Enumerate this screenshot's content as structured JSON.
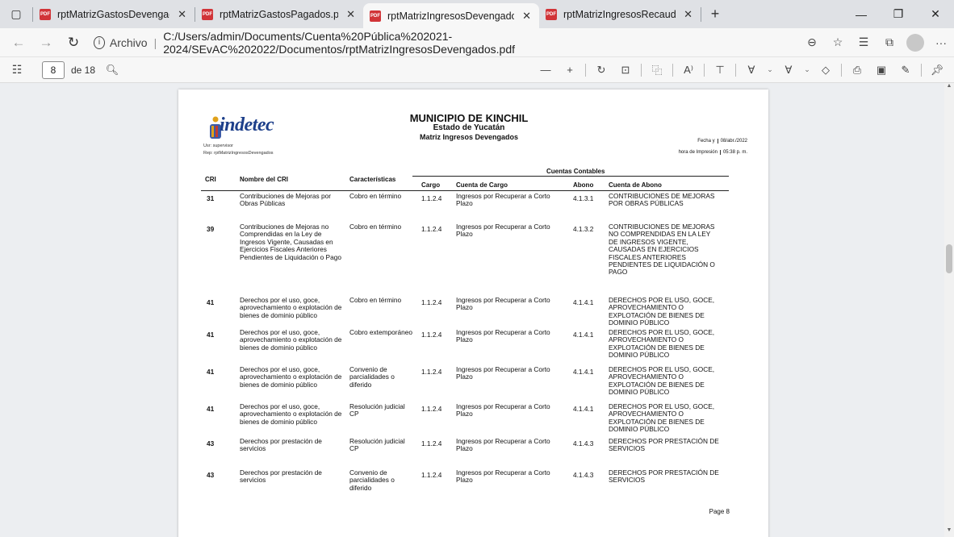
{
  "tabs": [
    {
      "title": "rptMatrizGastosDevengados.pdf",
      "active": false
    },
    {
      "title": "rptMatrizGastosPagados.pdf",
      "active": false
    },
    {
      "title": "rptMatrizIngresosDevengados.pc",
      "active": true
    },
    {
      "title": "rptMatrizIngresosRecaudados.pc",
      "active": false
    }
  ],
  "address": {
    "prefix": "Archivo",
    "url": "C:/Users/admin/Documents/Cuenta%20Pública%202021-2024/SEvAC%202022/Documentos/rptMatrizIngresosDevengados.pdf"
  },
  "pdf_toolbar": {
    "page_current": "8",
    "page_total": "de 18"
  },
  "report": {
    "logo_text": "indetec",
    "usr": "Usr: supervisor",
    "rep": "Rep: rptMatrizIngresosDevengados",
    "title": "MUNICIPIO DE KINCHIL",
    "state": "Estado de Yucatán",
    "subtitle": "Matriz Ingresos Devengados",
    "fecha_label": "Fecha y",
    "fecha_value": "08/abr./2022",
    "hora_label": "hora de Impresión",
    "hora_value": "05:38 p. m.",
    "headers": {
      "cri": "CRI",
      "nombre": "Nombre del CRI",
      "caracteristicas": "Características",
      "cuentas": "Cuentas Contables",
      "cargo": "Cargo",
      "cuenta_cargo": "Cuenta de Cargo",
      "abono": "Abono",
      "cuenta_abono": "Cuenta de Abono"
    },
    "rows": [
      {
        "cri": "31",
        "nombre": "Contribuciones de Mejoras por Obras Públicas",
        "car": "Cobro en término",
        "cargo": "1.1.2.4",
        "ccargo": "Ingresos por Recuperar a Corto Plazo",
        "abono": "4.1.3.1",
        "cabono": "CONTRIBUCIONES DE MEJORAS POR OBRAS PÚBLICAS"
      },
      {
        "cri": "39",
        "nombre": "Contribuciones de Mejoras no Comprendidas en la Ley de Ingresos Vigente, Causadas en Ejercicios Fiscales Anteriores Pendientes de Liquidación o Pago",
        "car": "Cobro en término",
        "cargo": "1.1.2.4",
        "ccargo": "Ingresos por Recuperar a Corto Plazo",
        "abono": "4.1.3.2",
        "cabono": "CONTRIBUCIONES DE MEJORAS NO COMPRENDIDAS EN LA LEY DE INGRESOS VIGENTE, CAUSADAS EN EJERCICIOS FISCALES ANTERIORES PENDIENTES DE LIQUIDACIÓN O PAGO"
      },
      {
        "cri": "41",
        "nombre": "Derechos por el uso, goce, aprovechamiento o explotación de bienes de dominio público",
        "car": "Cobro en término",
        "cargo": "1.1.2.4",
        "ccargo": "Ingresos por Recuperar a Corto Plazo",
        "abono": "4.1.4.1",
        "cabono": "DERECHOS POR EL USO, GOCE, APROVECHAMIENTO O EXPLOTACIÓN DE BIENES DE DOMINIO PÚBLICO"
      },
      {
        "cri": "41",
        "nombre": "Derechos por el uso, goce, aprovechamiento o explotación de bienes de dominio público",
        "car": "Cobro extemporáneo",
        "cargo": "1.1.2.4",
        "ccargo": "Ingresos por Recuperar a Corto Plazo",
        "abono": "4.1.4.1",
        "cabono": "DERECHOS POR EL USO, GOCE, APROVECHAMIENTO O EXPLOTACIÓN DE BIENES DE DOMINIO PÚBLICO"
      },
      {
        "cri": "41",
        "nombre": "Derechos por el uso, goce, aprovechamiento o explotación de bienes de dominio público",
        "car": "Convenio de parcialidades o diferido",
        "cargo": "1.1.2.4",
        "ccargo": "Ingresos por Recuperar a Corto Plazo",
        "abono": "4.1.4.1",
        "cabono": "DERECHOS POR EL USO, GOCE, APROVECHAMIENTO O EXPLOTACIÓN DE BIENES DE DOMINIO PÚBLICO"
      },
      {
        "cri": "41",
        "nombre": "Derechos por el uso, goce, aprovechamiento o explotación de bienes de dominio público",
        "car": "Resolución judicial CP",
        "cargo": "1.1.2.4",
        "ccargo": "Ingresos por Recuperar a Corto Plazo",
        "abono": "4.1.4.1",
        "cabono": "DERECHOS POR EL USO, GOCE, APROVECHAMIENTO O EXPLOTACIÓN DE BIENES DE DOMINIO PÚBLICO"
      },
      {
        "cri": "43",
        "nombre": "Derechos por prestación de servicios",
        "car": "Resolución judicial CP",
        "cargo": "1.1.2.4",
        "ccargo": "Ingresos por Recuperar a Corto Plazo",
        "abono": "4.1.4.3",
        "cabono": "DERECHOS POR PRESTACIÓN DE SERVICIOS"
      },
      {
        "cri": "43",
        "nombre": "Derechos por prestación de servicios",
        "car": "Convenio de parcialidades o diferido",
        "cargo": "1.1.2.4",
        "ccargo": "Ingresos por Recuperar a Corto Plazo",
        "abono": "4.1.4.3",
        "cabono": "DERECHOS POR PRESTACIÓN DE SERVICIOS"
      }
    ],
    "page_label": "Page 8"
  }
}
